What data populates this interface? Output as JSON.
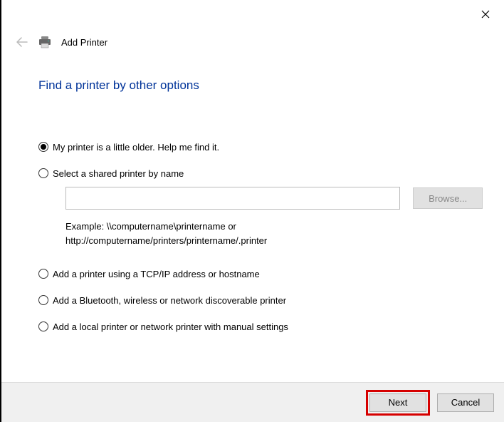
{
  "header": {
    "title": "Add Printer"
  },
  "mainTitle": "Find a printer by other options",
  "options": {
    "older": "My printer is a little older. Help me find it.",
    "shared": "Select a shared printer by name",
    "sharedExample1": "Example: \\\\computername\\printername or",
    "sharedExample2": "http://computername/printers/printername/.printer",
    "browse": "Browse...",
    "tcpip": "Add a printer using a TCP/IP address or hostname",
    "bluetooth": "Add a Bluetooth, wireless or network discoverable printer",
    "local": "Add a local printer or network printer with manual settings"
  },
  "footer": {
    "next": "Next",
    "cancel": "Cancel"
  }
}
